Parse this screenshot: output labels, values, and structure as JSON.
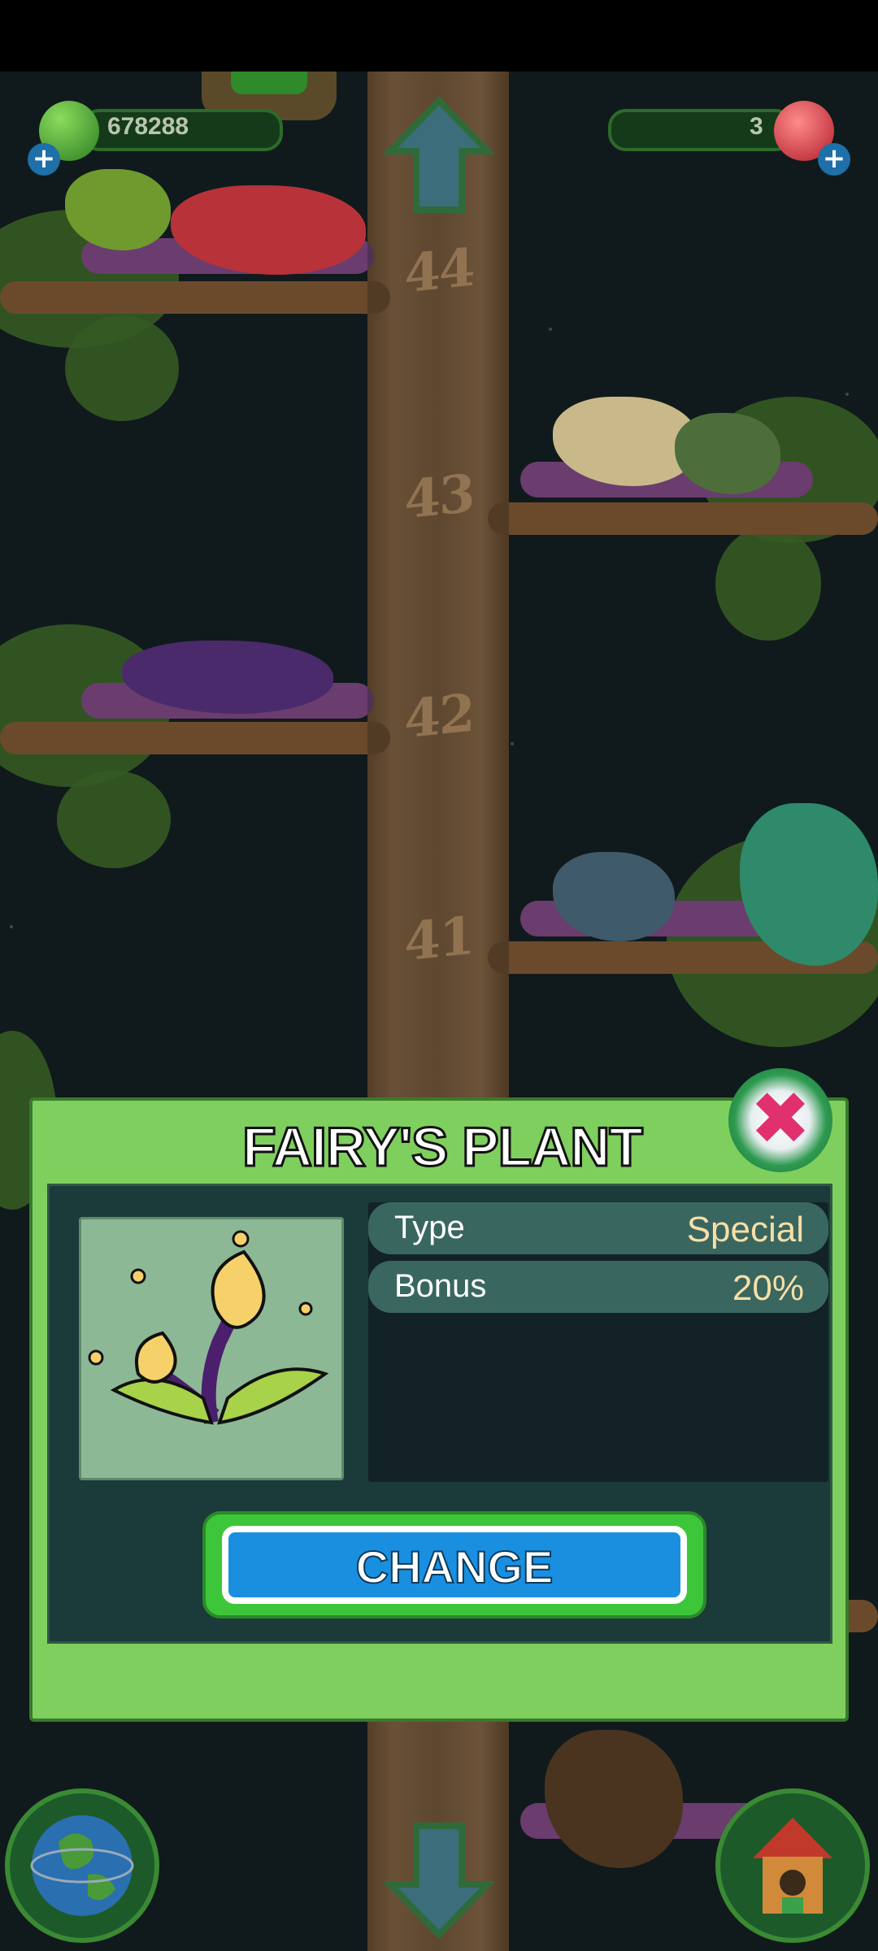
{
  "hud": {
    "coins": "678288",
    "gems": "3"
  },
  "tree": {
    "levels": [
      "44",
      "43",
      "42",
      "41"
    ]
  },
  "dialog": {
    "title": "FAIRY'S PLANT",
    "stats": [
      {
        "label": "Type",
        "value": "Special"
      },
      {
        "label": "Bonus",
        "value": "20%"
      }
    ],
    "change_label": "CHANGE"
  },
  "colors": {
    "dialog_green": "#7fcf5e",
    "button_blue": "#1a8fe0",
    "close_pink": "#e0306e"
  },
  "icons": {
    "close": "close-icon",
    "globe": "globe-icon",
    "house": "birdhouse-icon",
    "up": "arrow-up-icon",
    "down": "arrow-down-icon"
  }
}
